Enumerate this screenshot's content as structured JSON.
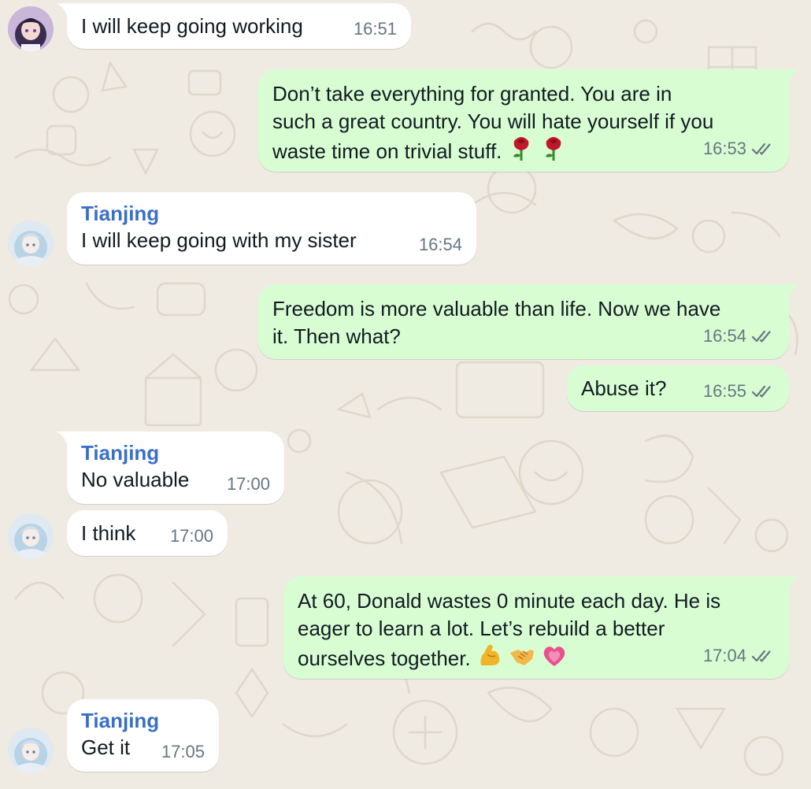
{
  "theme": {
    "incoming_bubble": "#ffffff",
    "outgoing_bubble": "#d9fdd3",
    "sender_name_color": "#3a6fc6",
    "timestamp_color": "#667781",
    "chat_background": "#efeae2"
  },
  "messages": [
    {
      "direction": "in",
      "avatar": "dark-haired-anime-avatar",
      "sender": "",
      "text": "I will keep going working",
      "time": "16:51"
    },
    {
      "direction": "out",
      "text_lines": [
        "Don’t take everything for granted. You are in",
        "such a great country. You will hate yourself if you",
        "waste time on trivial stuff."
      ],
      "emoji": [
        "rose-icon",
        "rose-icon"
      ],
      "time": "16:53",
      "status": "read"
    },
    {
      "direction": "in",
      "avatar": "light-haired-anime-avatar",
      "sender": "Tianjing",
      "text": "I will keep going with my sister",
      "time": "16:54"
    },
    {
      "direction": "out",
      "text_lines": [
        "Freedom is more valuable than life. Now we have",
        "it. Then what?"
      ],
      "time": "16:54",
      "status": "read"
    },
    {
      "direction": "out",
      "text": "Abuse it?",
      "time": "16:55",
      "status": "read"
    },
    {
      "direction": "in",
      "sender": "Tianjing",
      "text": "No valuable",
      "time": "17:00"
    },
    {
      "direction": "in",
      "avatar": "light-haired-anime-avatar",
      "text": "I think",
      "time": "17:00"
    },
    {
      "direction": "out",
      "text_lines": [
        "At 60, Donald wastes 0 minute each day. He is",
        "eager to learn a lot. Let’s rebuild a better",
        "ourselves together."
      ],
      "emoji": [
        "flexed-biceps-icon",
        "handshake-icon",
        "growing-heart-icon"
      ],
      "time": "17:04",
      "status": "read"
    },
    {
      "direction": "in",
      "avatar": "light-haired-anime-avatar",
      "sender": "Tianjing",
      "text": "Get it",
      "time": "17:05"
    }
  ]
}
